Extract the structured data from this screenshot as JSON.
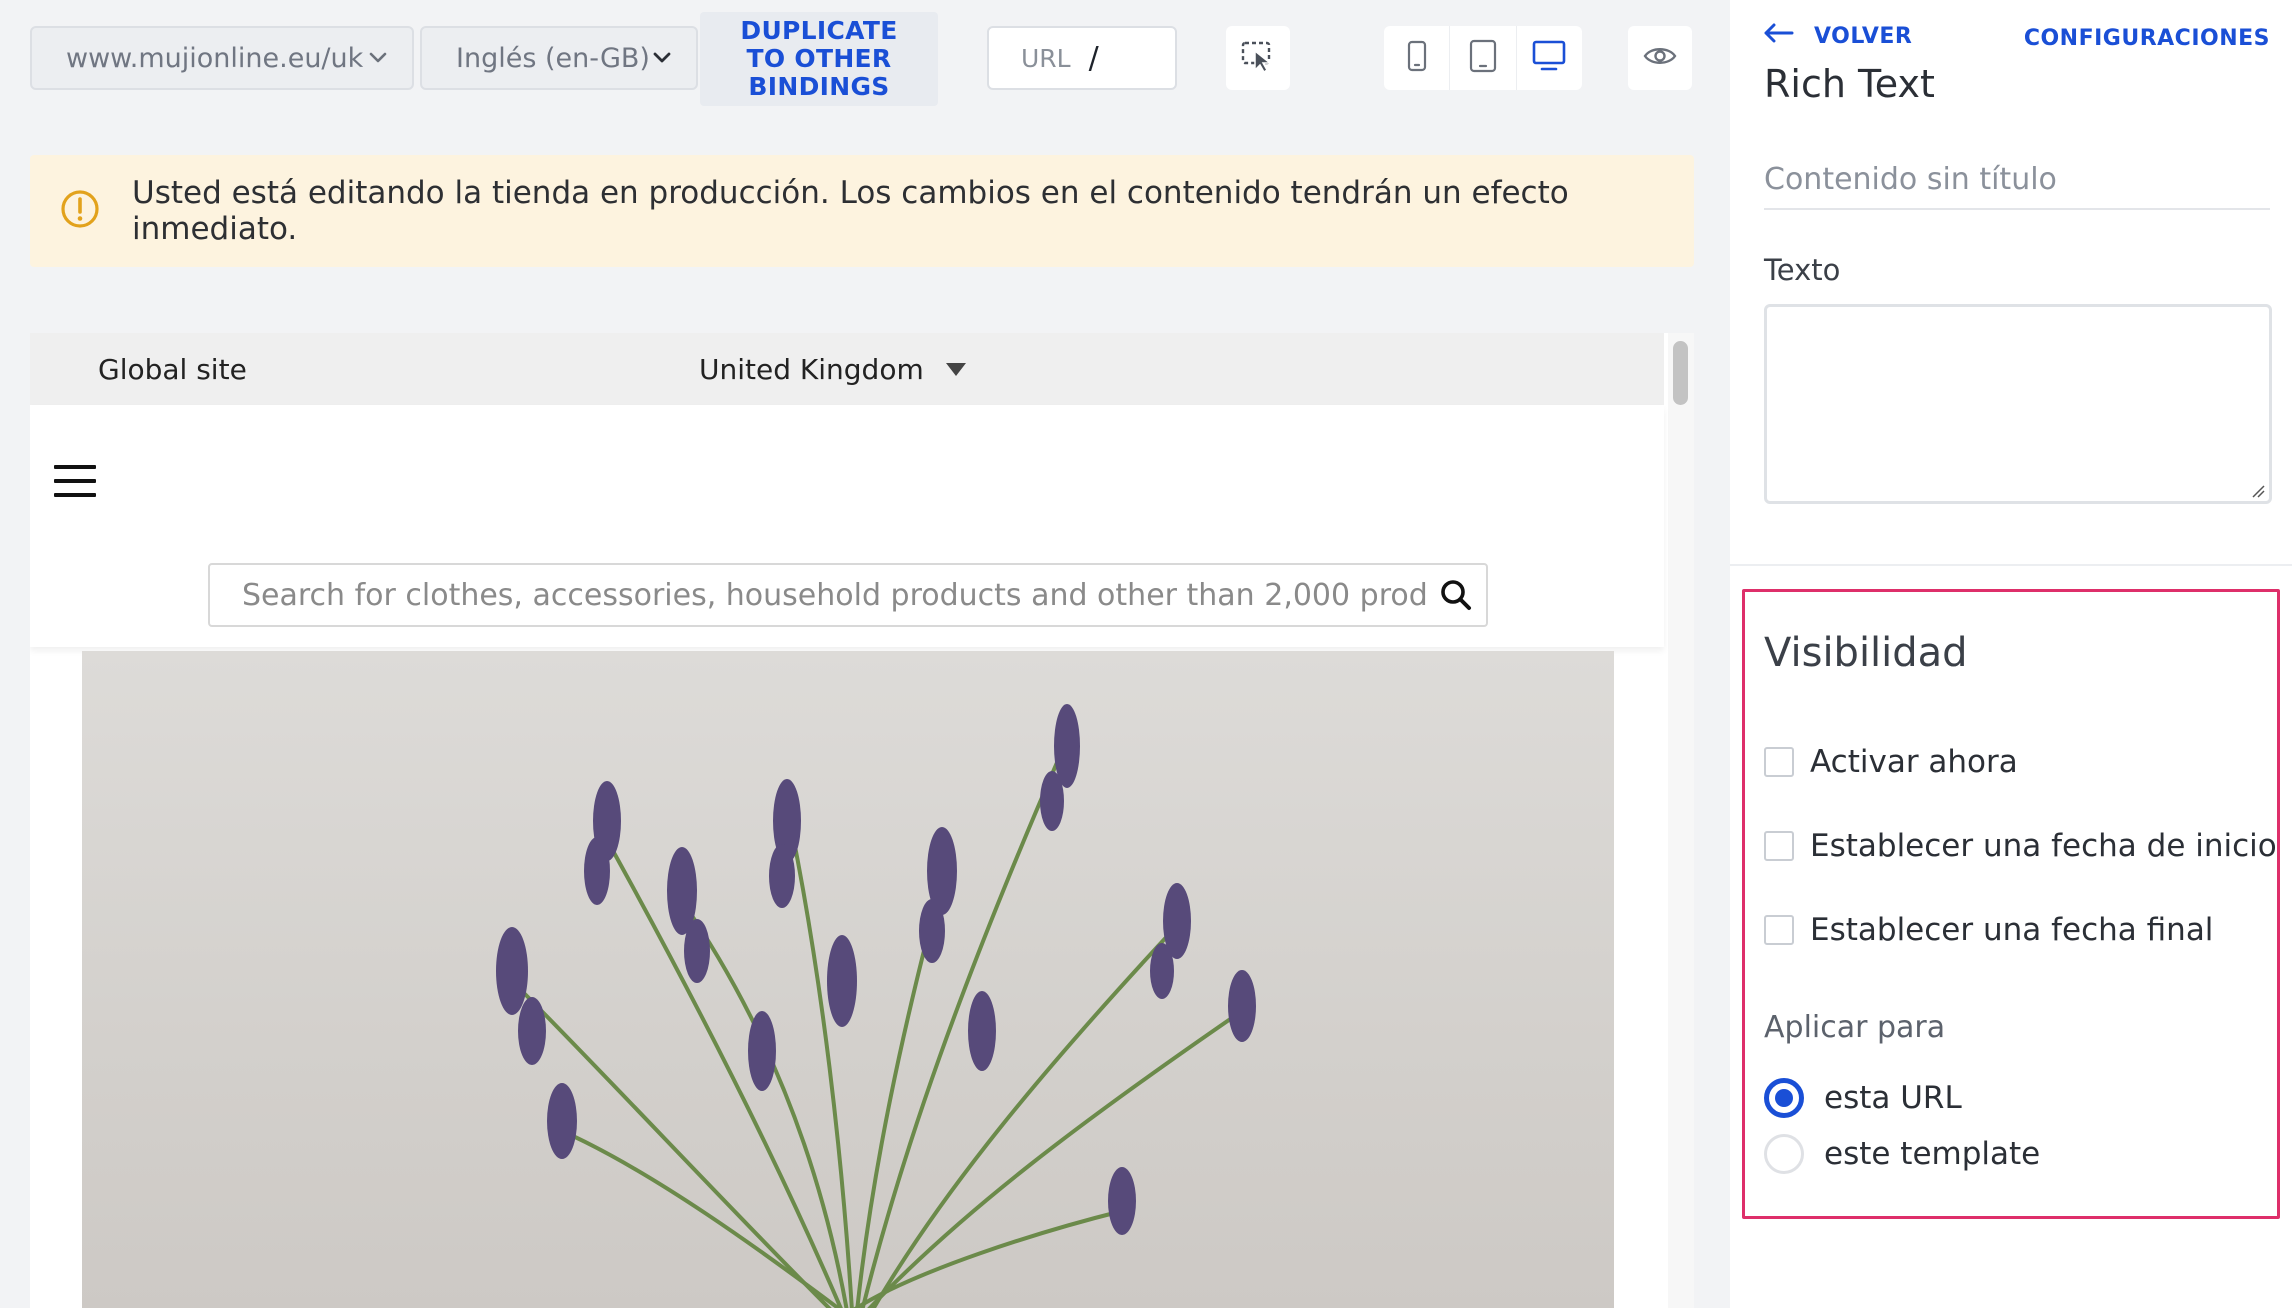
{
  "toolbar": {
    "domain_select": "www.mujionline.eu/uk",
    "language_select": "Inglés (en-GB)",
    "duplicate_button": "DUPLICATE TO OTHER BINDINGS",
    "url_label": "URL",
    "url_value": "/",
    "select_tool_icon": "cursor-select-icon",
    "devices": [
      "mobile-icon",
      "tablet-icon",
      "desktop-icon"
    ],
    "active_device": "desktop",
    "preview_icon": "eye-icon"
  },
  "banner": {
    "icon": "warning-circle-icon",
    "text": "Usted está editando la tienda en producción. Los cambios en el contenido tendrán un efecto inmediato."
  },
  "preview": {
    "topbar_left": "Global site",
    "topbar_country": "United Kingdom",
    "search_placeholder": "Search for clothes, accessories, household products and other than 2,000 prod",
    "hero_image": "lavender-bouquet"
  },
  "panel": {
    "back_label": "VOLVER",
    "settings_label": "CONFIGURACIONES",
    "title": "Rich Text",
    "title_placeholder": "Contenido sin título",
    "text_label": "Texto",
    "text_value": "",
    "visibility": {
      "title": "Visibilidad",
      "checkboxes": [
        {
          "label": "Activar ahora",
          "checked": false
        },
        {
          "label": "Establecer una fecha de inicio",
          "checked": false
        },
        {
          "label": "Establecer una fecha final",
          "checked": false
        }
      ],
      "apply_label": "Aplicar para",
      "radios": [
        {
          "label": "esta URL",
          "selected": true
        },
        {
          "label": "este template",
          "selected": false
        }
      ]
    }
  },
  "colors": {
    "accent": "#1a4fd6",
    "highlight_border": "#de2f6a",
    "banner_bg": "#fdf3df",
    "warning": "#e2a21c"
  }
}
